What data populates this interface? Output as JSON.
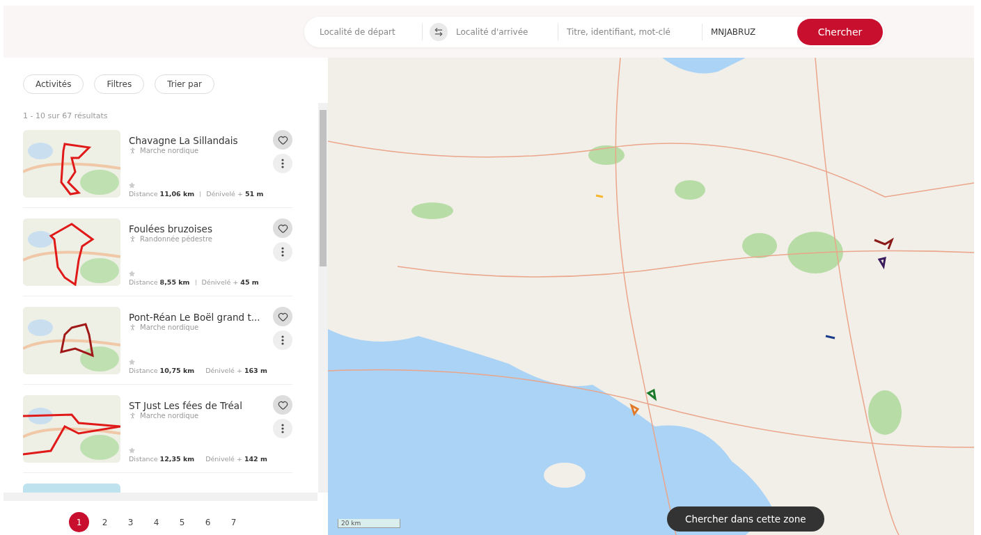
{
  "search_bar": {
    "departure": {
      "placeholder": "Localité de départ"
    },
    "arrival": {
      "placeholder": "Localité d'arrivée"
    },
    "keywords": {
      "placeholder": "Titre, identifiant, mot-clé"
    },
    "code": {
      "value": "MNJABRUZ"
    },
    "submit": "Chercher"
  },
  "filters": [
    "Activités",
    "Filtres",
    "Trier par"
  ],
  "results_count": "1 - 10 sur 67 résultats",
  "results": [
    {
      "title": "Chavagne La Sillandais",
      "activity": "Marche nordique",
      "distance_label": "Distance",
      "distance": "11,06 km",
      "elevation_label": "Dénivelé +",
      "elevation": "51 m"
    },
    {
      "title": "Foulées bruzoises",
      "activity": "Randonnée pédestre",
      "distance_label": "Distance",
      "distance": "8,55 km",
      "elevation_label": "Dénivelé +",
      "elevation": "45 m"
    },
    {
      "title": "Pont-Réan Le Boël grand t...",
      "activity": "Marche nordique",
      "distance_label": "Distance",
      "distance": "10,75 km",
      "elevation_label": "Dénivelé +",
      "elevation": "163 m"
    },
    {
      "title": "ST Just Les fées de Tréal",
      "activity": "Marche nordique",
      "distance_label": "Distance",
      "distance": "12,35 km",
      "elevation_label": "Dénivelé +",
      "elevation": "142 m"
    }
  ],
  "pagination": [
    {
      "label": "1",
      "selected": true
    },
    {
      "label": "2",
      "selected": false
    },
    {
      "label": "3",
      "selected": false
    },
    {
      "label": "4",
      "selected": false
    },
    {
      "label": "5",
      "selected": false
    },
    {
      "label": "6",
      "selected": false
    },
    {
      "label": "7",
      "selected": false
    }
  ],
  "map": {
    "scale": "20 km",
    "search_area_button": "Chercher dans cette zone"
  }
}
